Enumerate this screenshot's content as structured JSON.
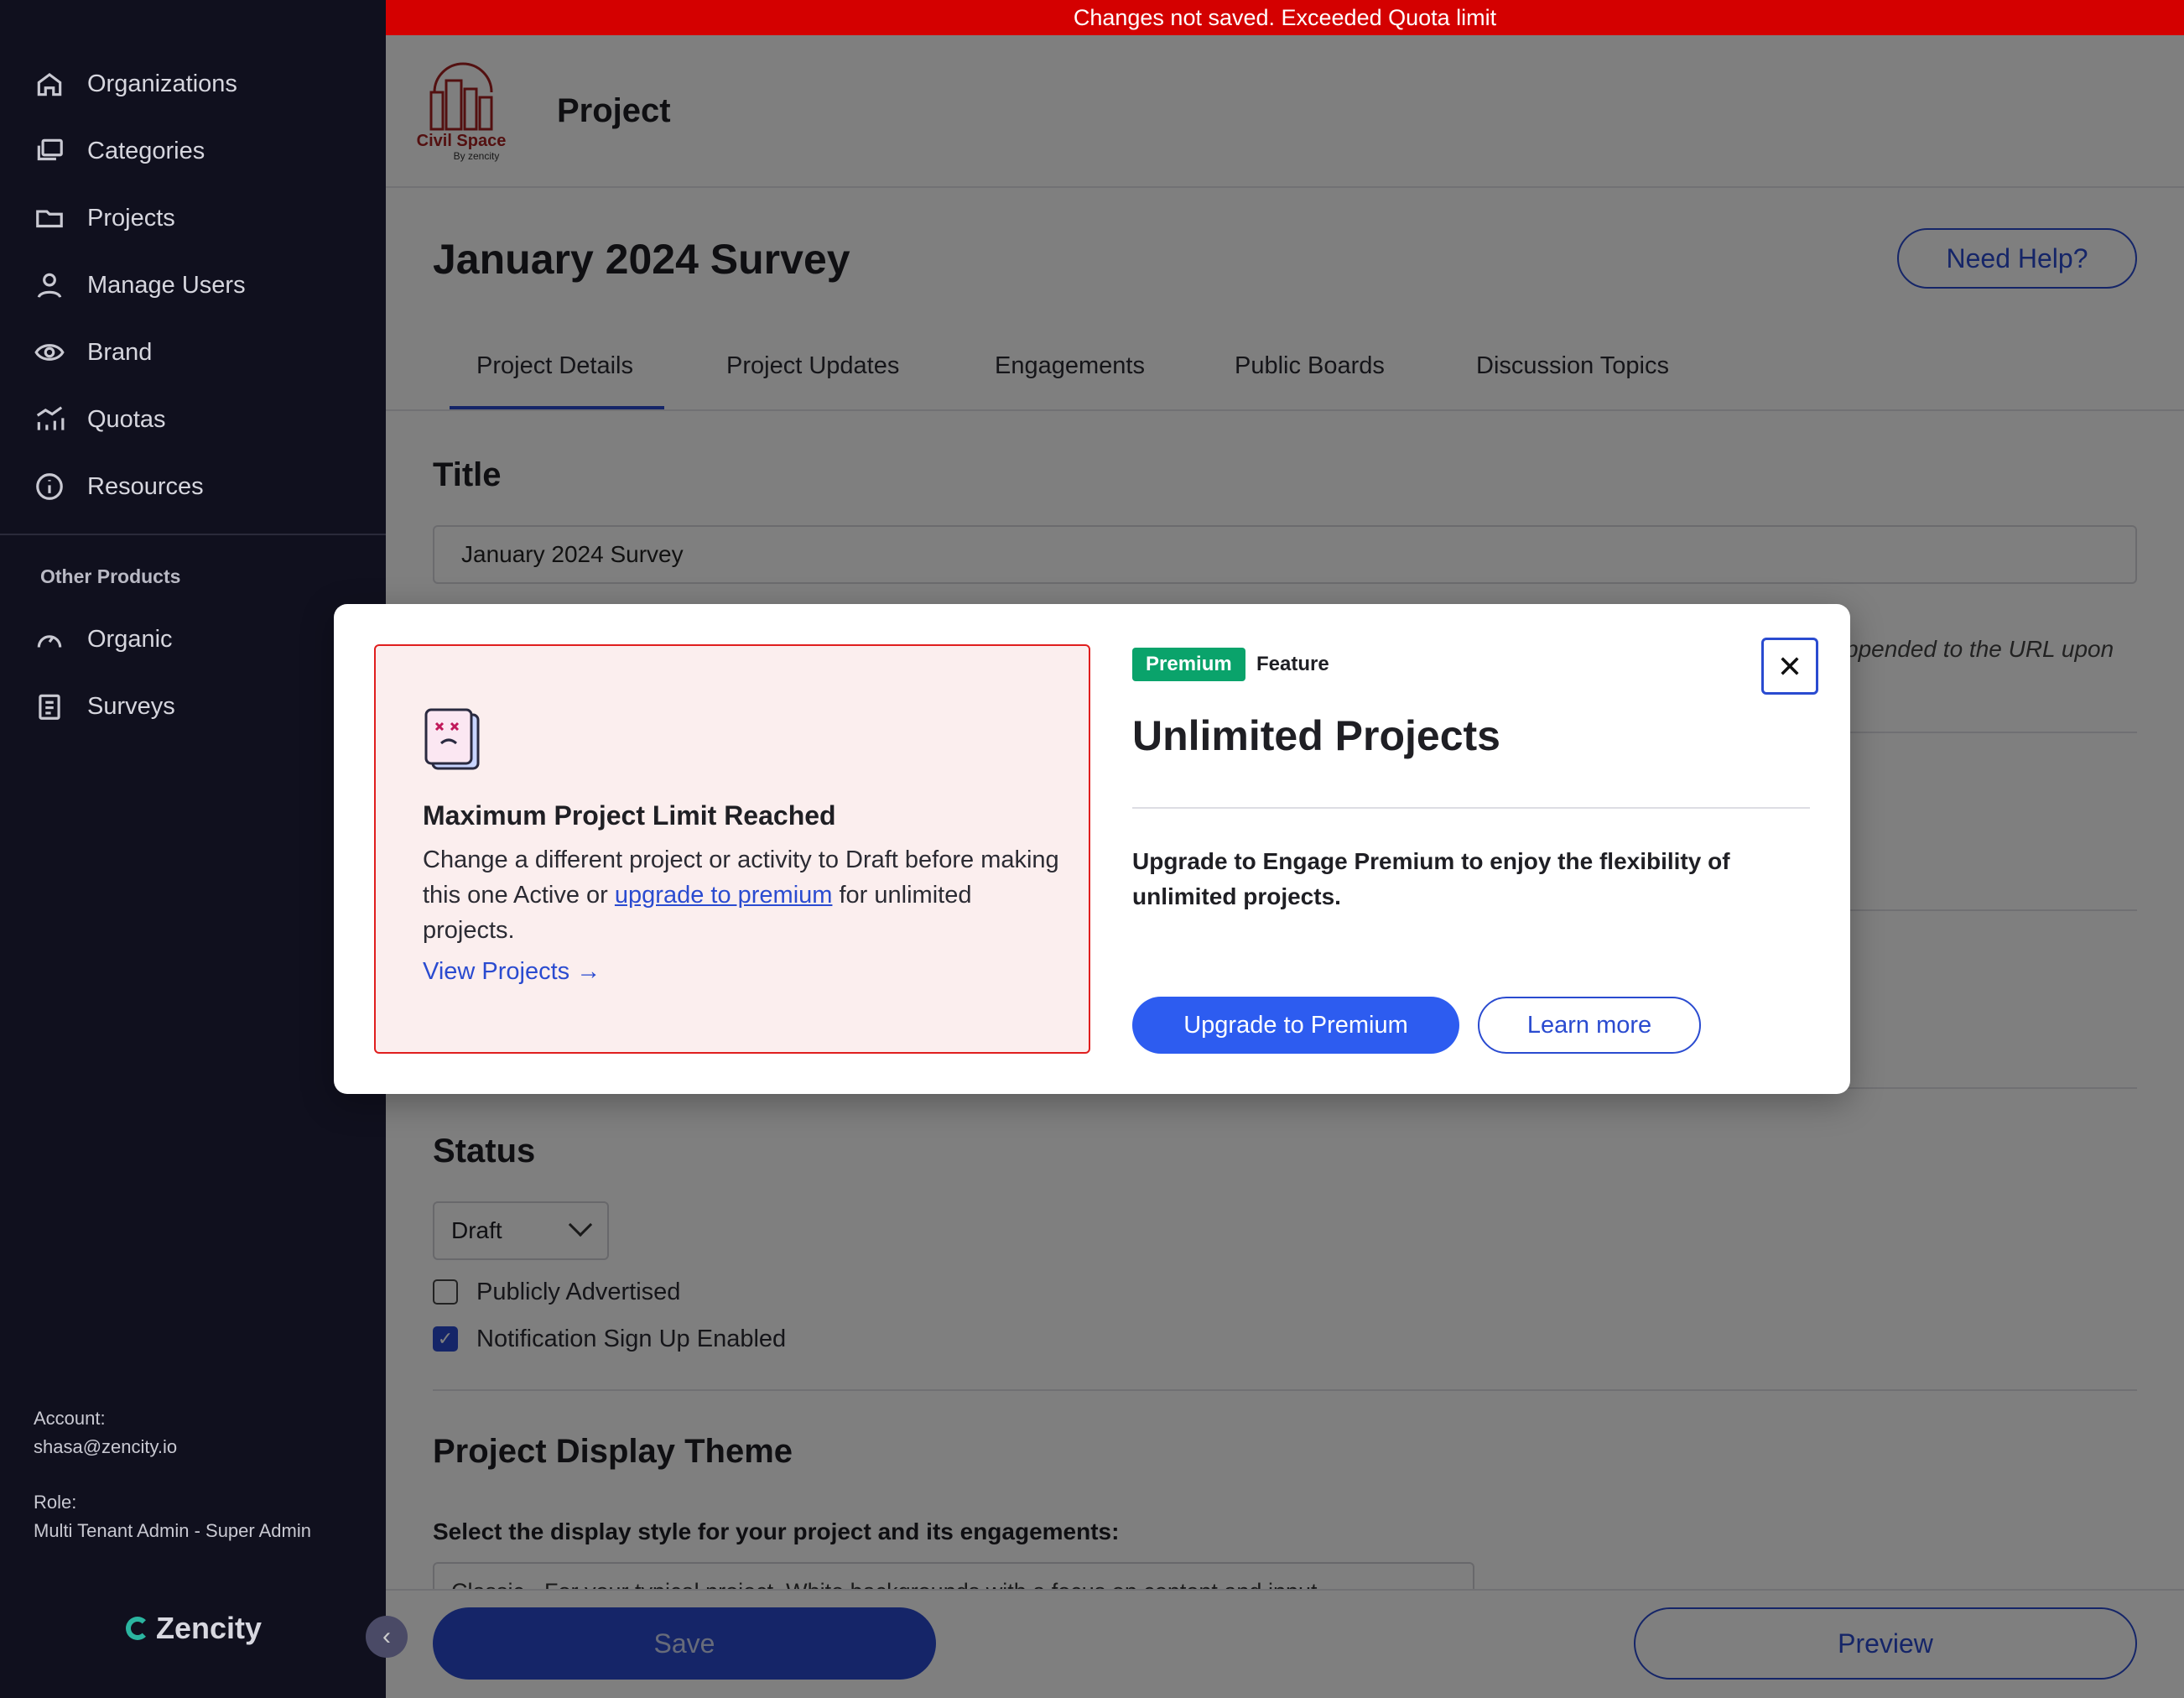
{
  "banner": {
    "text": "Changes not saved. Exceeded Quota limit"
  },
  "sidebar": {
    "items": [
      {
        "label": "Organizations",
        "icon": "home-icon"
      },
      {
        "label": "Categories",
        "icon": "stack-icon"
      },
      {
        "label": "Projects",
        "icon": "folder-icon"
      },
      {
        "label": "Manage Users",
        "icon": "user-icon"
      },
      {
        "label": "Brand",
        "icon": "eye-icon"
      },
      {
        "label": "Quotas",
        "icon": "chart-icon"
      },
      {
        "label": "Resources",
        "icon": "info-icon"
      }
    ],
    "section_label": "Other Products",
    "other_items": [
      {
        "label": "Organic",
        "icon": "gauge-icon"
      },
      {
        "label": "Surveys",
        "icon": "clipboard-icon"
      }
    ],
    "account_label": "Account:",
    "account_value": "shasa@zencity.io",
    "role_label": "Role:",
    "role_value": "Multi Tenant Admin - Super Admin",
    "logo_text": "Zencity"
  },
  "header": {
    "brand_name": "Civil Space",
    "brand_sub": "By zencity",
    "title": "Project"
  },
  "project": {
    "title": "January 2024 Survey",
    "help_label": "Need Help?"
  },
  "tabs": [
    {
      "label": "Project Details"
    },
    {
      "label": "Project Updates"
    },
    {
      "label": "Engagements"
    },
    {
      "label": "Public Boards"
    },
    {
      "label": "Discussion Topics"
    }
  ],
  "form": {
    "title_heading": "Title",
    "title_value": "January 2024 Survey",
    "helper_text": "ppended to the URL upon",
    "status_heading": "Status",
    "status_value": "Draft",
    "checkbox_advertised": "Publicly Advertised",
    "checkbox_notifications": "Notification Sign Up Enabled",
    "theme_heading": "Project Display Theme",
    "theme_label": "Select the display style for your project and its engagements:",
    "theme_value": "Classic - For your typical project. White backgrounds with a focus on content and input"
  },
  "footer": {
    "save_label": "Save",
    "preview_label": "Preview"
  },
  "modal": {
    "error_title": "Maximum Project Limit Reached",
    "error_body_before": "Change a different project or activity to Draft before making this one Active or ",
    "error_link": "upgrade to premium",
    "error_body_after": " for unlimited projects.",
    "view_projects": "View Projects →",
    "badge": "Premium",
    "badge_suffix": "Feature",
    "heading": "Unlimited Projects",
    "description": "Upgrade to Engage Premium to enjoy the flexibility of unlimited projects.",
    "upgrade_label": "Upgrade to Premium",
    "learn_label": "Learn more"
  },
  "colors": {
    "accent": "#2a4bd0",
    "banner": "#d40000",
    "premium": "#0aa36b",
    "error_border": "#e01e1e",
    "sidebar_bg": "#10101e"
  }
}
